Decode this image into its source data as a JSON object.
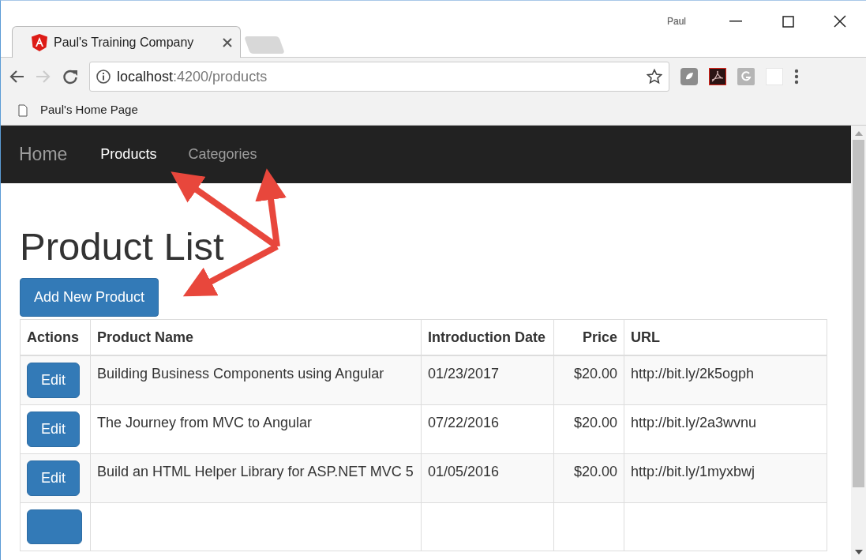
{
  "browser": {
    "tab_title": "Paul's Training Company",
    "profile": "Paul",
    "url_host": "localhost",
    "url_rest": ":4200/products",
    "bookmark": "Paul's Home Page"
  },
  "navbar": {
    "brand": "Home",
    "links": [
      {
        "label": "Products",
        "selected": true
      },
      {
        "label": "Categories",
        "selected": false
      }
    ]
  },
  "heading": "Product List",
  "add_button": "Add New Product",
  "table": {
    "columns": [
      {
        "label": "Actions",
        "kind": "text"
      },
      {
        "label": "Product Name",
        "kind": "text"
      },
      {
        "label": "Introduction Date",
        "kind": "text"
      },
      {
        "label": "Price",
        "kind": "money"
      },
      {
        "label": "URL",
        "kind": "text"
      }
    ],
    "rows": [
      {
        "action": "Edit",
        "name": "Building Business Components using Angular",
        "date": "01/23/2017",
        "price": "$20.00",
        "url": "http://bit.ly/2k5ogph"
      },
      {
        "action": "Edit",
        "name": "The Journey from MVC to Angular",
        "date": "07/22/2016",
        "price": "$20.00",
        "url": "http://bit.ly/2a3wvnu"
      },
      {
        "action": "Edit",
        "name": "Build an HTML Helper Library for ASP.NET MVC 5",
        "date": "01/05/2016",
        "price": "$20.00",
        "url": "http://bit.ly/1myxbwj"
      }
    ]
  }
}
